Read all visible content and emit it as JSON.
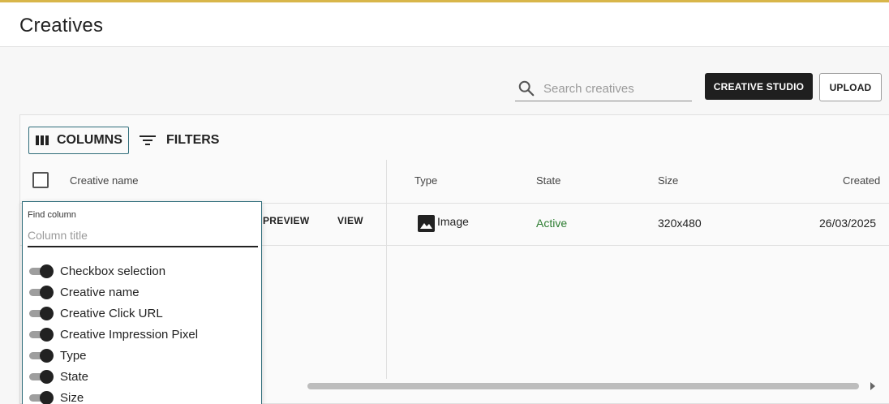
{
  "colors": {
    "accent_bar": "#d8b64a",
    "primary_dark": "#1f1f1f",
    "focus_teal": "#2f6d7a",
    "state_active": "#2e7d32"
  },
  "header": {
    "title": "Creatives"
  },
  "toolbar": {
    "search_placeholder": "Search creatives",
    "creative_studio_label": "CREATIVE STUDIO",
    "upload_label": "UPLOAD"
  },
  "grid": {
    "columns_button_label": "COLUMNS",
    "filters_button_label": "FILTERS",
    "column_headers": {
      "creative_name": "Creative name",
      "type": "Type",
      "state": "State",
      "size": "Size",
      "created": "Created"
    },
    "row": {
      "preview_label": "PREVIEW",
      "view_label": "VIEW",
      "type": "Image",
      "type_icon": "image-icon",
      "state": "Active",
      "size": "320x480",
      "created": "26/03/2025"
    }
  },
  "column_panel": {
    "find_label": "Find column",
    "find_placeholder": "Column title",
    "items": [
      {
        "label": "Checkbox selection",
        "enabled": true
      },
      {
        "label": "Creative name",
        "enabled": true
      },
      {
        "label": "Creative Click URL",
        "enabled": true
      },
      {
        "label": "Creative Impression Pixel",
        "enabled": true
      },
      {
        "label": "Type",
        "enabled": true
      },
      {
        "label": "State",
        "enabled": true
      },
      {
        "label": "Size",
        "enabled": true
      }
    ]
  }
}
